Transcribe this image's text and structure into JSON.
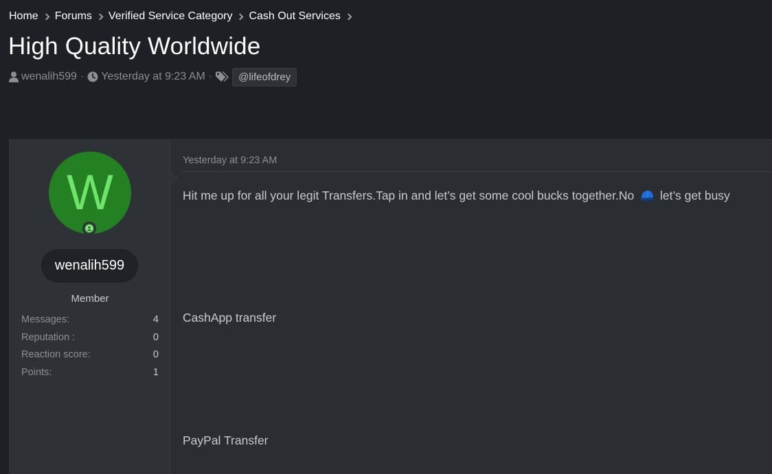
{
  "breadcrumb": {
    "items": [
      "Home",
      "Forums",
      "Verified Service Category",
      "Cash Out Services"
    ]
  },
  "thread": {
    "title": "High Quality Worldwide",
    "author": "wenalih599",
    "date": "Yesterday at 9:23 AM",
    "tag": "@lifeofdrey"
  },
  "user": {
    "avatar_letter": "W",
    "name": "wenalih599",
    "title": "Member",
    "stats": [
      {
        "label": "Messages:",
        "value": "4"
      },
      {
        "label": "Reputation :",
        "value": "0"
      },
      {
        "label": "Reaction score:",
        "value": "0"
      },
      {
        "label": "Points:",
        "value": "1"
      }
    ]
  },
  "post": {
    "date": "Yesterday at 9:23 AM",
    "line1_before": "Hit me up for all your legit Transfers.Tap in and let’s get some cool bucks together.No",
    "line1_after": "let’s get busy",
    "line2": "CashApp transfer",
    "line3": "PayPal Transfer"
  },
  "colors": {
    "background": "#1d2024",
    "avatar_bg": "#248121",
    "avatar_letter": "#6ee46a"
  },
  "icons": [
    "user-icon",
    "clock-icon",
    "tags-icon",
    "chevron-right-icon",
    "cap-emoji-icon",
    "online-status-icon"
  ]
}
